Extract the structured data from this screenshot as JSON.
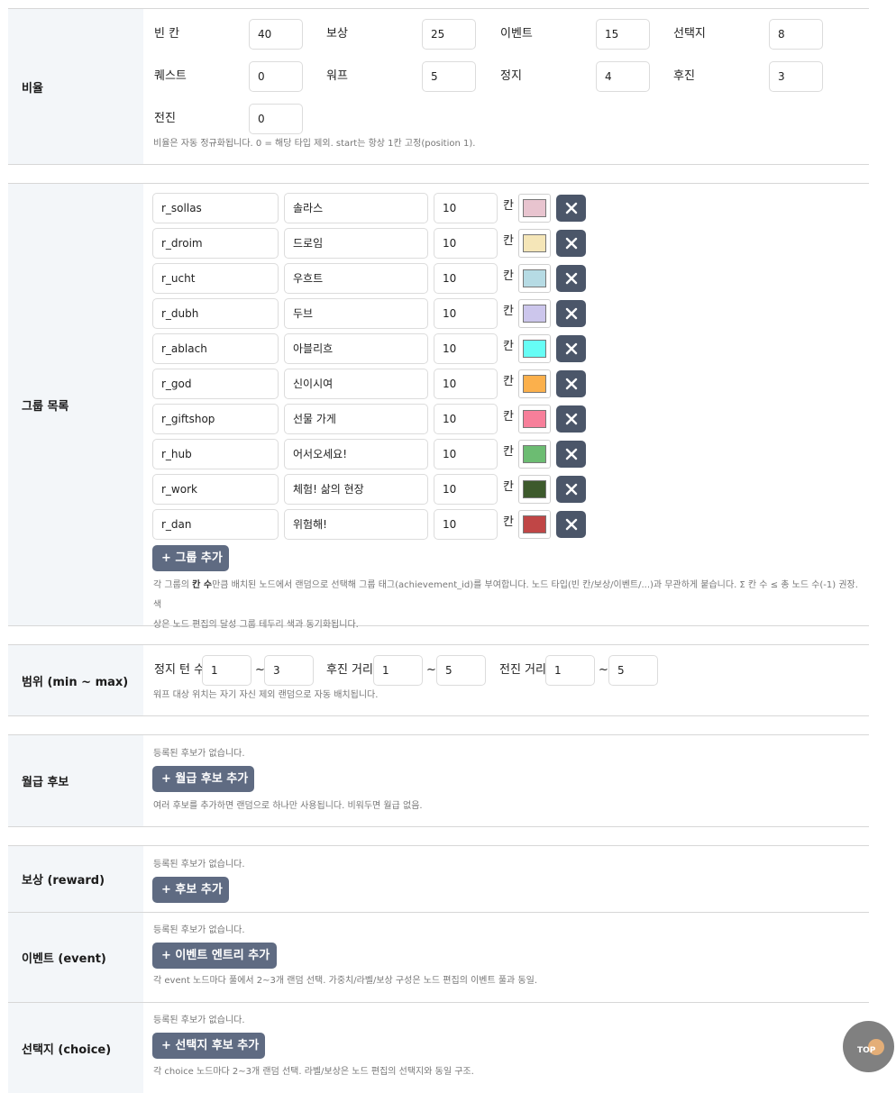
{
  "ratio": {
    "label": "비율",
    "fields": [
      {
        "label": "빈 칸",
        "value": "40"
      },
      {
        "label": "보상",
        "value": "25"
      },
      {
        "label": "이벤트",
        "value": "15"
      },
      {
        "label": "선택지",
        "value": "8"
      },
      {
        "label": "퀘스트",
        "value": "0"
      },
      {
        "label": "워프",
        "value": "5"
      },
      {
        "label": "정지",
        "value": "4"
      },
      {
        "label": "후진",
        "value": "3"
      },
      {
        "label": "전진",
        "value": "0"
      }
    ],
    "help": "비율은 자동 정규화됩니다. 0 = 해당 타입 제외. start는 항상 1칸 고정(position 1)."
  },
  "groups": {
    "label": "그룹 목록",
    "unit": "칸",
    "items": [
      {
        "id": "r_sollas",
        "name": "솔라스",
        "count": "10",
        "color": "#e8c4cf"
      },
      {
        "id": "r_droim",
        "name": "드로임",
        "count": "10",
        "color": "#f5e6b8"
      },
      {
        "id": "r_ucht",
        "name": "우흐트",
        "count": "10",
        "color": "#b6dbe4"
      },
      {
        "id": "r_dubh",
        "name": "두브",
        "count": "10",
        "color": "#ccc6ec"
      },
      {
        "id": "r_ablach",
        "name": "아블리흐",
        "count": "10",
        "color": "#66fdf5"
      },
      {
        "id": "r_god",
        "name": "신이시여",
        "count": "10",
        "color": "#fbb04c"
      },
      {
        "id": "r_giftshop",
        "name": "선물 가게",
        "count": "10",
        "color": "#f77f9a"
      },
      {
        "id": "r_hub",
        "name": "어서오세요!",
        "count": "10",
        "color": "#6cbc72"
      },
      {
        "id": "r_work",
        "name": "체험! 삶의 현장",
        "count": "10",
        "color": "#3d5a2c"
      },
      {
        "id": "r_dan",
        "name": "위험해!",
        "count": "10",
        "color": "#c04646"
      }
    ],
    "add_label": "+ 그룹 추가",
    "help_pre": "각 그룹의 ",
    "help_bold": "칸 수",
    "help_post": "만큼 배치된 노드에서 랜덤으로 선택해 그룹 태그(achievement_id)를 부여합니다. 노드 타입(빈 칸/보상/이벤트/...)과 무관하게 붙습니다. Σ 칸 수 ≤ 총 노드 수(-1) 권장. 색",
    "help_line2": "상은 노드 편집의 달성 그룹 테두리 색과 동기화됩니다."
  },
  "range": {
    "label": "범위 (min ~ max)",
    "items": [
      {
        "label": "정지 턴 수",
        "min": "1",
        "max": "3"
      },
      {
        "label": "후진 거리",
        "min": "1",
        "max": "5"
      },
      {
        "label": "전진 거리",
        "min": "1",
        "max": "5"
      }
    ],
    "sep": "~",
    "help": "워프 대상 위치는 자기 자신 제외 랜덤으로 자동 배치됩니다."
  },
  "salary": {
    "label": "월급 후보",
    "empty": "등록된 후보가 없습니다.",
    "add_label": "+ 월급 후보 추가",
    "help": "여러 후보를 추가하면 랜덤으로 하나만 사용됩니다. 비워두면 월급 없음."
  },
  "reward": {
    "label": "보상 (reward)",
    "empty": "등록된 후보가 없습니다.",
    "add_label": "+ 후보 추가"
  },
  "event": {
    "label": "이벤트 (event)",
    "empty": "등록된 후보가 없습니다.",
    "add_label": "+ 이벤트 엔트리 추가",
    "help": "각 event 노드마다 풀에서 2~3개 랜덤 선택. 가중치/라벨/보상 구성은 노드 편집의 이벤트 풀과 동일."
  },
  "choice": {
    "label": "선택지 (choice)",
    "empty": "등록된 후보가 없습니다.",
    "add_label": "+ 선택지 후보 추가",
    "help": "각 choice 노드마다 2~3개 랜덤 선택. 라벨/보상은 노드 편집의 선택지와 동일 구조."
  },
  "top_button": {
    "label": "TOP"
  }
}
